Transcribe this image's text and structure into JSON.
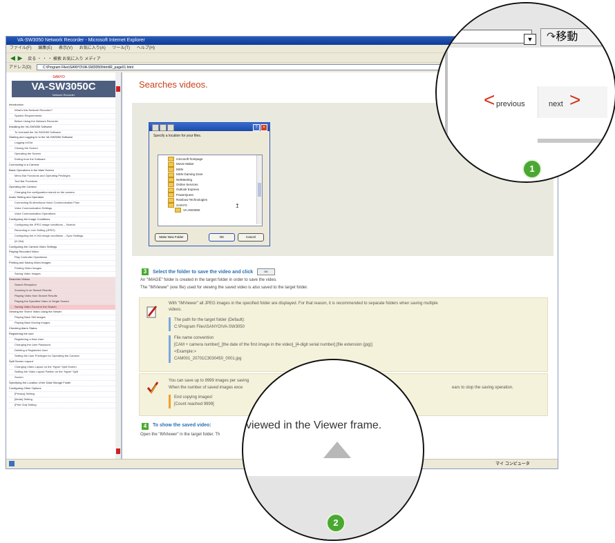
{
  "browser": {
    "title": "VA-SW3050 Network Recorder - Microsoft Internet Explorer",
    "menu": [
      "ファイル(F)",
      "編集(E)",
      "表示(V)",
      "お気に入り(A)",
      "ツール(T)",
      "ヘルプ(H)"
    ],
    "toolbar_text": "戻る ・ ・ ・ 検索 お気に入り メディア",
    "address_label": "アドレス(D)",
    "address_value": "C:\\Program Files\\SANYO\\VA-SW3050\\html\\R_page01.html",
    "status_zone": "マイ コンピュータ"
  },
  "sidebar": {
    "brand": "SANYO",
    "product": "VA-SW3050C",
    "product_sub": "Network Recorder",
    "toc": [
      {
        "text": "Introduction",
        "level": 0,
        "state": ""
      },
      {
        "text": "What's this Network Recorder?",
        "level": 1,
        "state": ""
      },
      {
        "text": "System Requirements",
        "level": 1,
        "state": ""
      },
      {
        "text": "Before Using the Network Recorder",
        "level": 1,
        "state": ""
      },
      {
        "text": "Installing the VA-SW3050 Software",
        "level": 0,
        "state": ""
      },
      {
        "text": "To Uninstall the VA-SW3050 Software",
        "level": 1,
        "state": ""
      },
      {
        "text": "Starting and Logging In to the VA-SW3050 Software",
        "level": 0,
        "state": ""
      },
      {
        "text": "Logging In/Out",
        "level": 1,
        "state": ""
      },
      {
        "text": "Closing the Screen",
        "level": 1,
        "state": ""
      },
      {
        "text": "Operating the Screen",
        "level": 1,
        "state": ""
      },
      {
        "text": "Exiting from the Software",
        "level": 1,
        "state": ""
      },
      {
        "text": "Connecting to a Camera",
        "level": 0,
        "state": ""
      },
      {
        "text": "Basic Operations in the Main Screen",
        "level": 0,
        "state": ""
      },
      {
        "text": "Menu Bar Functions and Operating Privileges",
        "level": 1,
        "state": ""
      },
      {
        "text": "Tool Bar Functions",
        "level": 1,
        "state": ""
      },
      {
        "text": "Operating the Camera",
        "level": 0,
        "state": ""
      },
      {
        "text": "Changing the configuration stored on the camera",
        "level": 1,
        "state": ""
      },
      {
        "text": "Audio Setting and Operation",
        "level": 0,
        "state": ""
      },
      {
        "text": "Connecting Bi-directional Voice Communication Flow",
        "level": 1,
        "state": ""
      },
      {
        "text": "Voice Communication Settings",
        "level": 1,
        "state": ""
      },
      {
        "text": "Voice Communication Operations",
        "level": 1,
        "state": ""
      },
      {
        "text": "Configuring the Image Conditions",
        "level": 0,
        "state": ""
      },
      {
        "text": "Configuring the JPEG image conditions -- Normal",
        "level": 1,
        "state": ""
      },
      {
        "text": "Recording in Live Setting (JPEG)",
        "level": 1,
        "state": ""
      },
      {
        "text": "Configuring the H.264 image conditions -- Sync Settings",
        "level": 1,
        "state": ""
      },
      {
        "text": "(H.264)",
        "level": 1,
        "state": ""
      },
      {
        "text": "Configuring the Camera Video Settings",
        "level": 0,
        "state": ""
      },
      {
        "text": "Playing Recorded Video",
        "level": 0,
        "state": ""
      },
      {
        "text": "Play Controller Operations",
        "level": 1,
        "state": ""
      },
      {
        "text": "Printing and Saving Video Images",
        "level": 0,
        "state": ""
      },
      {
        "text": "Printing Video Images",
        "level": 1,
        "state": ""
      },
      {
        "text": "Saving Video Images",
        "level": 1,
        "state": ""
      },
      {
        "text": "Searches Videos",
        "level": 0,
        "state": "hl"
      },
      {
        "text": "Search Reception",
        "level": 1,
        "state": "hl"
      },
      {
        "text": "Zooming in on Search Results",
        "level": 1,
        "state": "hl"
      },
      {
        "text": "Playing Video from Search Results",
        "level": 1,
        "state": "hl"
      },
      {
        "text": "Playing the Specified Video in Single Screen",
        "level": 1,
        "state": "hl"
      },
      {
        "text": "Saving Video Found in the Search",
        "level": 1,
        "state": "sel"
      },
      {
        "text": "Viewing the 'Event' Video Using the Viewer",
        "level": 0,
        "state": ""
      },
      {
        "text": "Playing Back Still Images",
        "level": 1,
        "state": ""
      },
      {
        "text": "Playing Back Moving Images",
        "level": 1,
        "state": ""
      },
      {
        "text": "Checking Alarm Status",
        "level": 0,
        "state": ""
      },
      {
        "text": "Registering the user",
        "level": 0,
        "state": ""
      },
      {
        "text": "Registering a New User",
        "level": 1,
        "state": ""
      },
      {
        "text": "Changing the User Password",
        "level": 1,
        "state": ""
      },
      {
        "text": "Deleting a Registered User",
        "level": 1,
        "state": ""
      },
      {
        "text": "Setting the User Privileges for Operating the Camera",
        "level": 1,
        "state": ""
      },
      {
        "text": "Split Screen Layout",
        "level": 0,
        "state": ""
      },
      {
        "text": "Changing Video Layout on the 'Hyper' Split Screen",
        "level": 1,
        "state": ""
      },
      {
        "text": "Setting the Video Layout Pattern on the 'Hyper' Split",
        "level": 1,
        "state": ""
      },
      {
        "text": "Screen",
        "level": 1,
        "state": ""
      },
      {
        "text": "Specifying the Location of the Data Storage Folder",
        "level": 0,
        "state": ""
      },
      {
        "text": "Configuring Other Options",
        "level": 0,
        "state": ""
      },
      {
        "text": "[Privacy] Setting",
        "level": 1,
        "state": ""
      },
      {
        "text": "[Mode] Setting",
        "level": 1,
        "state": ""
      },
      {
        "text": "[Print Out] Setting",
        "level": 1,
        "state": ""
      }
    ]
  },
  "content": {
    "title": "Searches videos.",
    "dialog": {
      "prompt": "Specify a location for your files.",
      "tree": [
        {
          "label": "microsoft frontpage",
          "indent": 1
        },
        {
          "label": "Movie Maker",
          "indent": 1
        },
        {
          "label": "MSN",
          "indent": 1
        },
        {
          "label": "MSN Gaming Zone",
          "indent": 1
        },
        {
          "label": "NetMeeting",
          "indent": 1
        },
        {
          "label": "Online Services",
          "indent": 1
        },
        {
          "label": "Outlook Express",
          "indent": 1
        },
        {
          "label": "PowerQuest",
          "indent": 1
        },
        {
          "label": "Rainbow Technologies",
          "indent": 1
        },
        {
          "label": "SANYO",
          "indent": 1
        },
        {
          "label": "VA-SW3050",
          "indent": 2
        }
      ],
      "new_folder": "Make New Folder",
      "ok": "OK",
      "cancel": "Cancel"
    },
    "step3": {
      "num": "3",
      "title": "Select the folder to save the video and click",
      "button": "OK",
      "line1": "An \"IMAGE\" folder is created in the target folder in order to save the video.",
      "line2": "The \"IMViewer\" (exe file) used for viewing the saved video is also saved to the target folder."
    },
    "note1": {
      "text1": "With \"IMViewer\" all JPEG images in the specified folder are displayed. For that reason, it is recommended to separate folders when saving multiple",
      "text2": "videos.",
      "path_label": "The path for the target folder (Default):",
      "path_value": "C:\\Program Files\\SANYO\\VA-SW3050",
      "conv_label": "File name convention",
      "conv_value": "[CAM + camera number]_[the date of the first image in the video]_[4-digit serial number].[file extension (jpg)]",
      "example_label": "<Example:>",
      "example_value": "CAM001_20701C3030450_0001.jpg"
    },
    "note2": {
      "text1": "You can save up to 9999 images per saving",
      "text2": "When the number of saved images exce",
      "text2_right": "ears to stop the saving operation.",
      "end1": "End copying images!",
      "end2": "[Count reached 9999]"
    },
    "step4": {
      "num": "4",
      "title": "To show the saved video:",
      "line": "Open the \"IMViewer\" in the target folder. Th"
    }
  },
  "magnifier1": {
    "go_label": "移動",
    "previous": "previous",
    "next": "next",
    "badge": "1"
  },
  "magnifier2": {
    "text": "viewed in the Viewer frame.",
    "badge": "2"
  }
}
